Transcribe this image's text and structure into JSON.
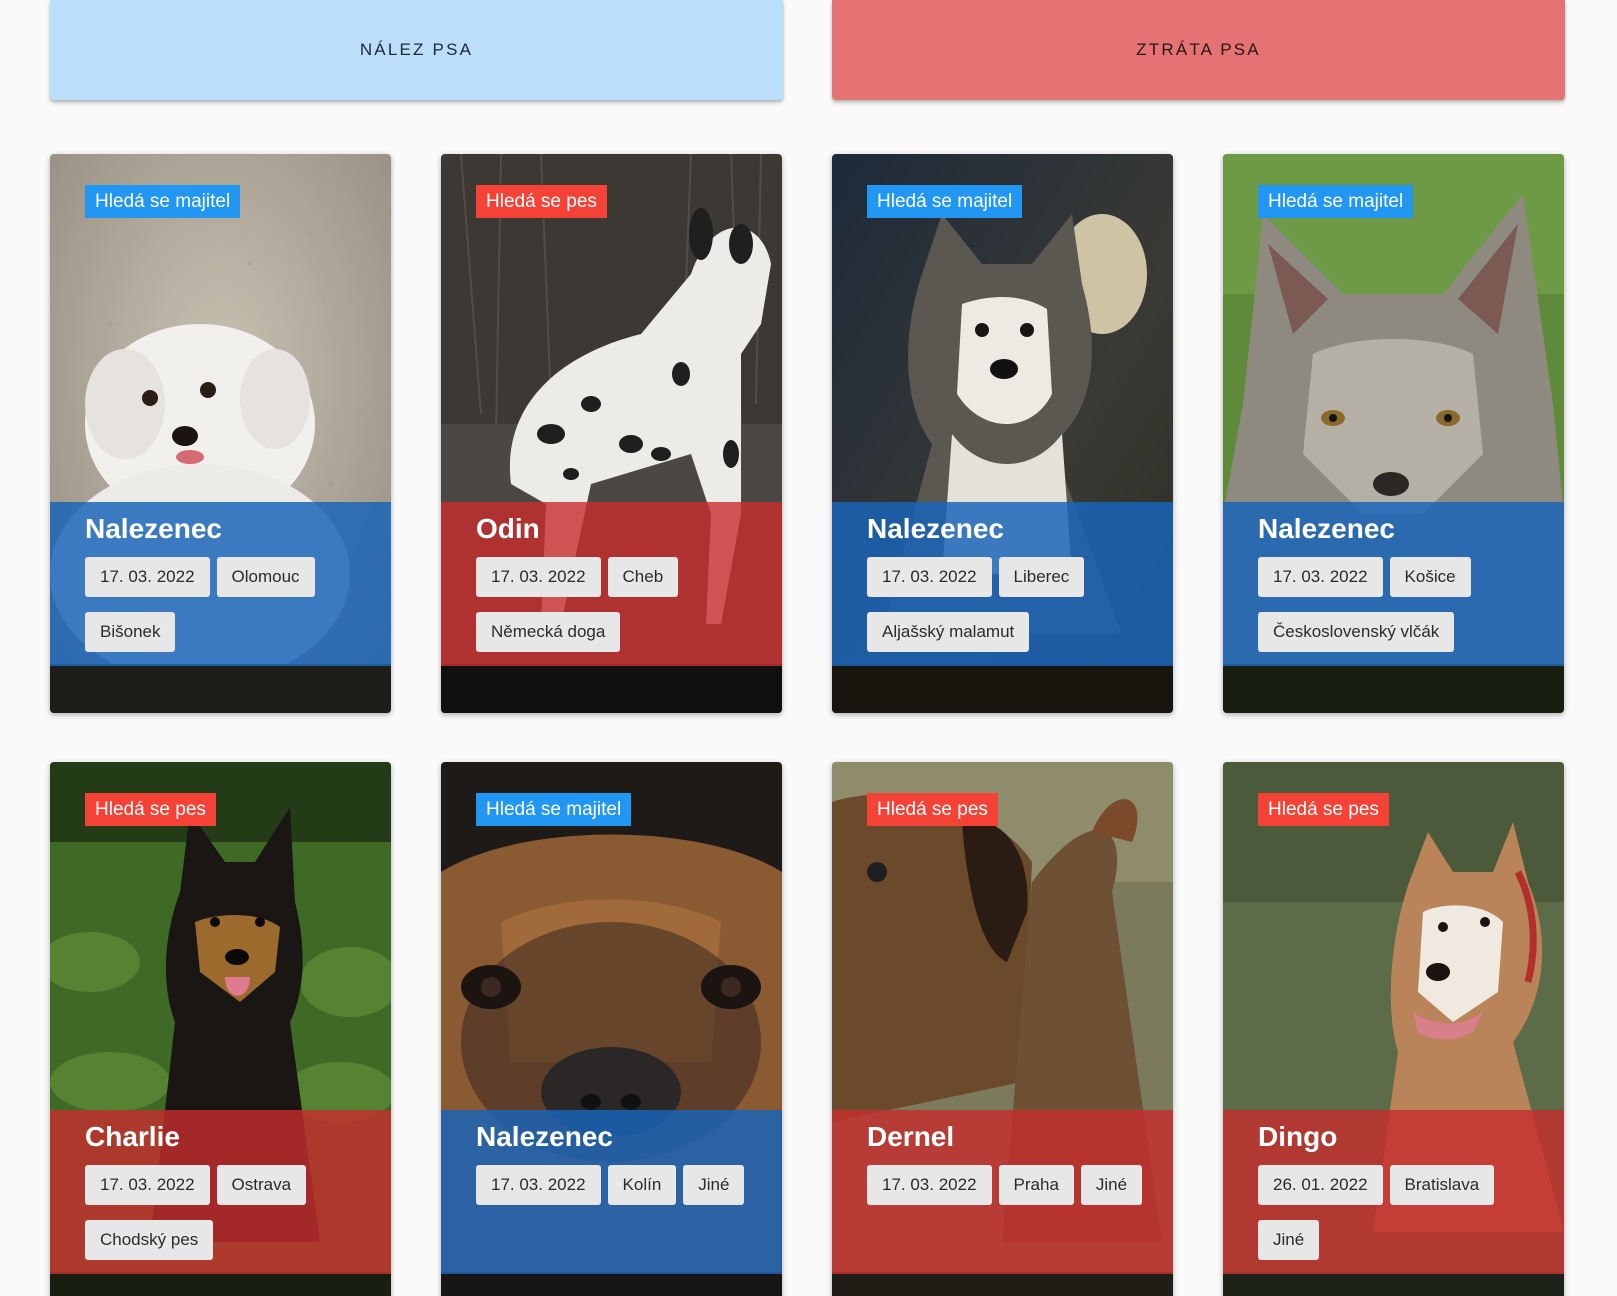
{
  "top_buttons": {
    "found_label": "NÁLEZ PSA",
    "lost_label": "ZTRÁTA PSA"
  },
  "colors": {
    "found_button": "#bbdefb",
    "lost_button": "#e57373",
    "badge_found": "#2196f3",
    "badge_lost": "#f44336",
    "overlay_found": "#1964b9",
    "overlay_lost": "#c82d2d"
  },
  "cards": [
    {
      "badge": "Hledá se majitel",
      "status": "found",
      "title": "Nalezenec",
      "date": "17. 03. 2022",
      "city": "Olomouc",
      "breed": "Bišonek",
      "photo_icon": "white-puppy-photo"
    },
    {
      "badge": "Hledá se pes",
      "status": "lost",
      "title": "Odin",
      "date": "17. 03. 2022",
      "city": "Cheb",
      "breed": "Německá doga",
      "photo_icon": "great-dane-photo"
    },
    {
      "badge": "Hledá se majitel",
      "status": "found",
      "title": "Nalezenec",
      "date": "17. 03. 2022",
      "city": "Liberec",
      "breed": "Aljašský malamut",
      "photo_icon": "malamute-photo"
    },
    {
      "badge": "Hledá se majitel",
      "status": "found",
      "title": "Nalezenec",
      "date": "17. 03. 2022",
      "city": "Košice",
      "breed": "Československý vlčák",
      "photo_icon": "wolfdog-photo"
    },
    {
      "badge": "Hledá se pes",
      "status": "lost",
      "title": "Charlie",
      "date": "17. 03. 2022",
      "city": "Ostrava",
      "breed": "Chodský pes",
      "photo_icon": "chodsky-dog-photo"
    },
    {
      "badge": "Hledá se majitel",
      "status": "found",
      "title": "Nalezenec",
      "date": "17. 03. 2022",
      "city": "Kolín",
      "breed": "Jiné",
      "photo_icon": "dog-face-photo"
    },
    {
      "badge": "Hledá se pes",
      "status": "lost",
      "title": "Dernel",
      "date": "17. 03. 2022",
      "city": "Praha",
      "breed": "Jiné",
      "photo_icon": "brown-dog-photo"
    },
    {
      "badge": "Hledá se pes",
      "status": "lost",
      "title": "Dingo",
      "date": "26. 01. 2022",
      "city": "Bratislava",
      "breed": "Jiné",
      "photo_icon": "staffordshire-photo"
    }
  ]
}
